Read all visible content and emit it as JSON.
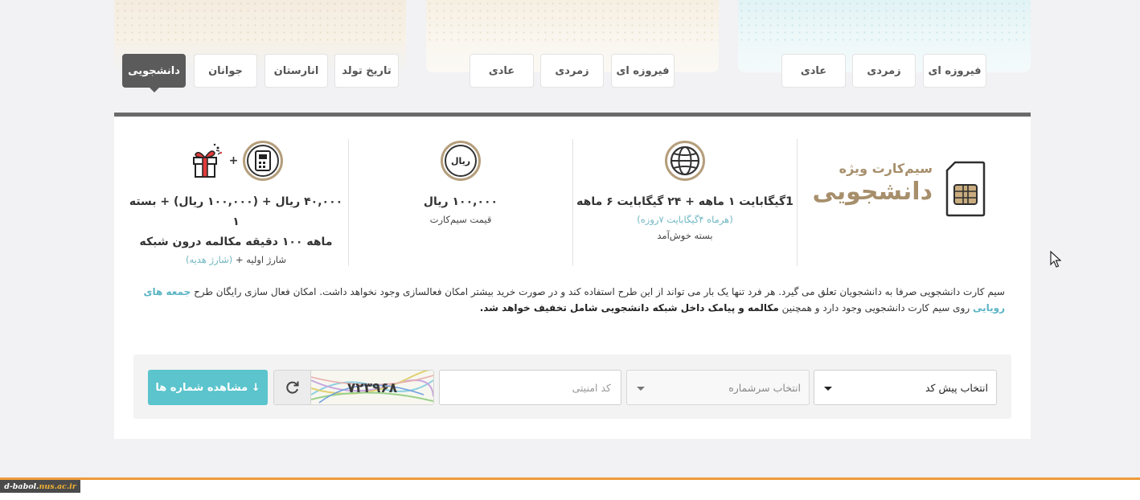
{
  "tabs_left": [
    {
      "label": "دانشجویی",
      "active": true
    },
    {
      "label": "جوانان",
      "active": false
    },
    {
      "label": "انارستان",
      "active": false
    },
    {
      "label": "تاریخ تولد",
      "active": false
    }
  ],
  "tabs_mid": [
    {
      "label": "فیروزه ای"
    },
    {
      "label": "زمردی"
    },
    {
      "label": "عادی"
    }
  ],
  "tabs_right": [
    {
      "label": "فیروزه ای"
    },
    {
      "label": "زمردی"
    },
    {
      "label": "عادی"
    }
  ],
  "brand": {
    "small": "سیم‌کارت ویژه",
    "big": "دانشجویی"
  },
  "features": {
    "internet": {
      "main": "1گیگابایت ۱ ماهه + ۲۴ گیگابایت ۶ ماهه",
      "note": "(هرماه ۴گیگابایت ۷روزه)",
      "caption": "بسته خوش‌آمد"
    },
    "price": {
      "icon_text": "ریال",
      "main": "۱۰۰,۰۰۰ ریال",
      "caption": "قیمت سیم‌کارت"
    },
    "charge": {
      "plus": "+",
      "main_line1": "۴۰,۰۰۰ ریال + (۱۰۰,۰۰۰ ریال) + بسته ۱",
      "main_line2": "ماهه ۱۰۰ دقیقه مکالمه درون شبکه",
      "caption_a": "شارژ اولیه + ",
      "caption_b": "(شارژ هدیه)"
    }
  },
  "description": {
    "part1": "سیم کارت دانشجویی صرفا به دانشجویان تعلق می گیرد. هر فرد تنها یک بار می تواند از این طرح استفاده کند و در صورت خرید بیشتر امکان فعالسازی وجود نخواهد داشت. امکان فعال سازی رایگان طرح ",
    "link": "جمعه های رویایی",
    "part2": " روی سیم کارت دانشجویی وجود دارد و همچنین ",
    "bold": "مکالمه و پیامک داخل شبکه دانشجویی شامل تخفیف خواهد شد."
  },
  "form": {
    "prefix_select": "انتخاب پیش کد",
    "series_select": "انتخاب سرشماره",
    "security_placeholder": "کد امنیتی",
    "captcha_text": "۷۲۳۹۶۸",
    "view_button": "↓ مشاهده شماره ها"
  },
  "footer": {
    "tag_a": "d-babol.",
    "tag_b": "nus.ac.ir"
  },
  "colors": {
    "accent_teal": "#5bc4cd",
    "brand_gold": "#a78f6c",
    "active_tab": "#5b5b5b",
    "footer_orange": "#ef9a3a"
  }
}
